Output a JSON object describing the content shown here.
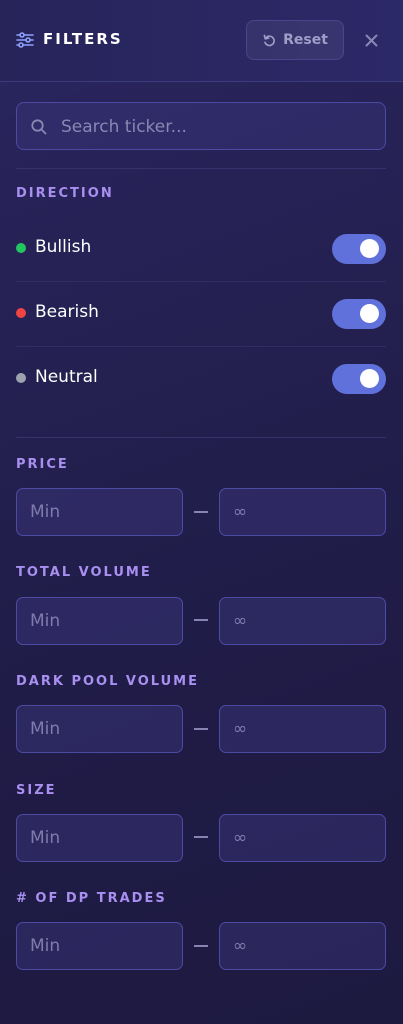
{
  "header": {
    "title": "FILTERS",
    "reset_label": "Reset"
  },
  "search": {
    "placeholder": "Search ticker..."
  },
  "direction": {
    "label": "DIRECTION",
    "items": [
      {
        "label": "Bullish",
        "color": "#22c55e",
        "enabled": true
      },
      {
        "label": "Bearish",
        "color": "#ef4444",
        "enabled": true
      },
      {
        "label": "Neutral",
        "color": "#9ca3af",
        "enabled": true
      }
    ]
  },
  "ranges": [
    {
      "label": "PRICE",
      "min_placeholder": "Min",
      "max_placeholder": "∞"
    },
    {
      "label": "TOTAL VOLUME",
      "min_placeholder": "Min",
      "max_placeholder": "∞"
    },
    {
      "label": "DARK POOL VOLUME",
      "min_placeholder": "Min",
      "max_placeholder": "∞"
    },
    {
      "label": "SIZE",
      "min_placeholder": "Min",
      "max_placeholder": "∞"
    },
    {
      "label": "# OF DP TRADES",
      "min_placeholder": "Min",
      "max_placeholder": "∞"
    }
  ],
  "colors": {
    "accent": "#a88ff0",
    "toggle_on": "#6171dc"
  }
}
